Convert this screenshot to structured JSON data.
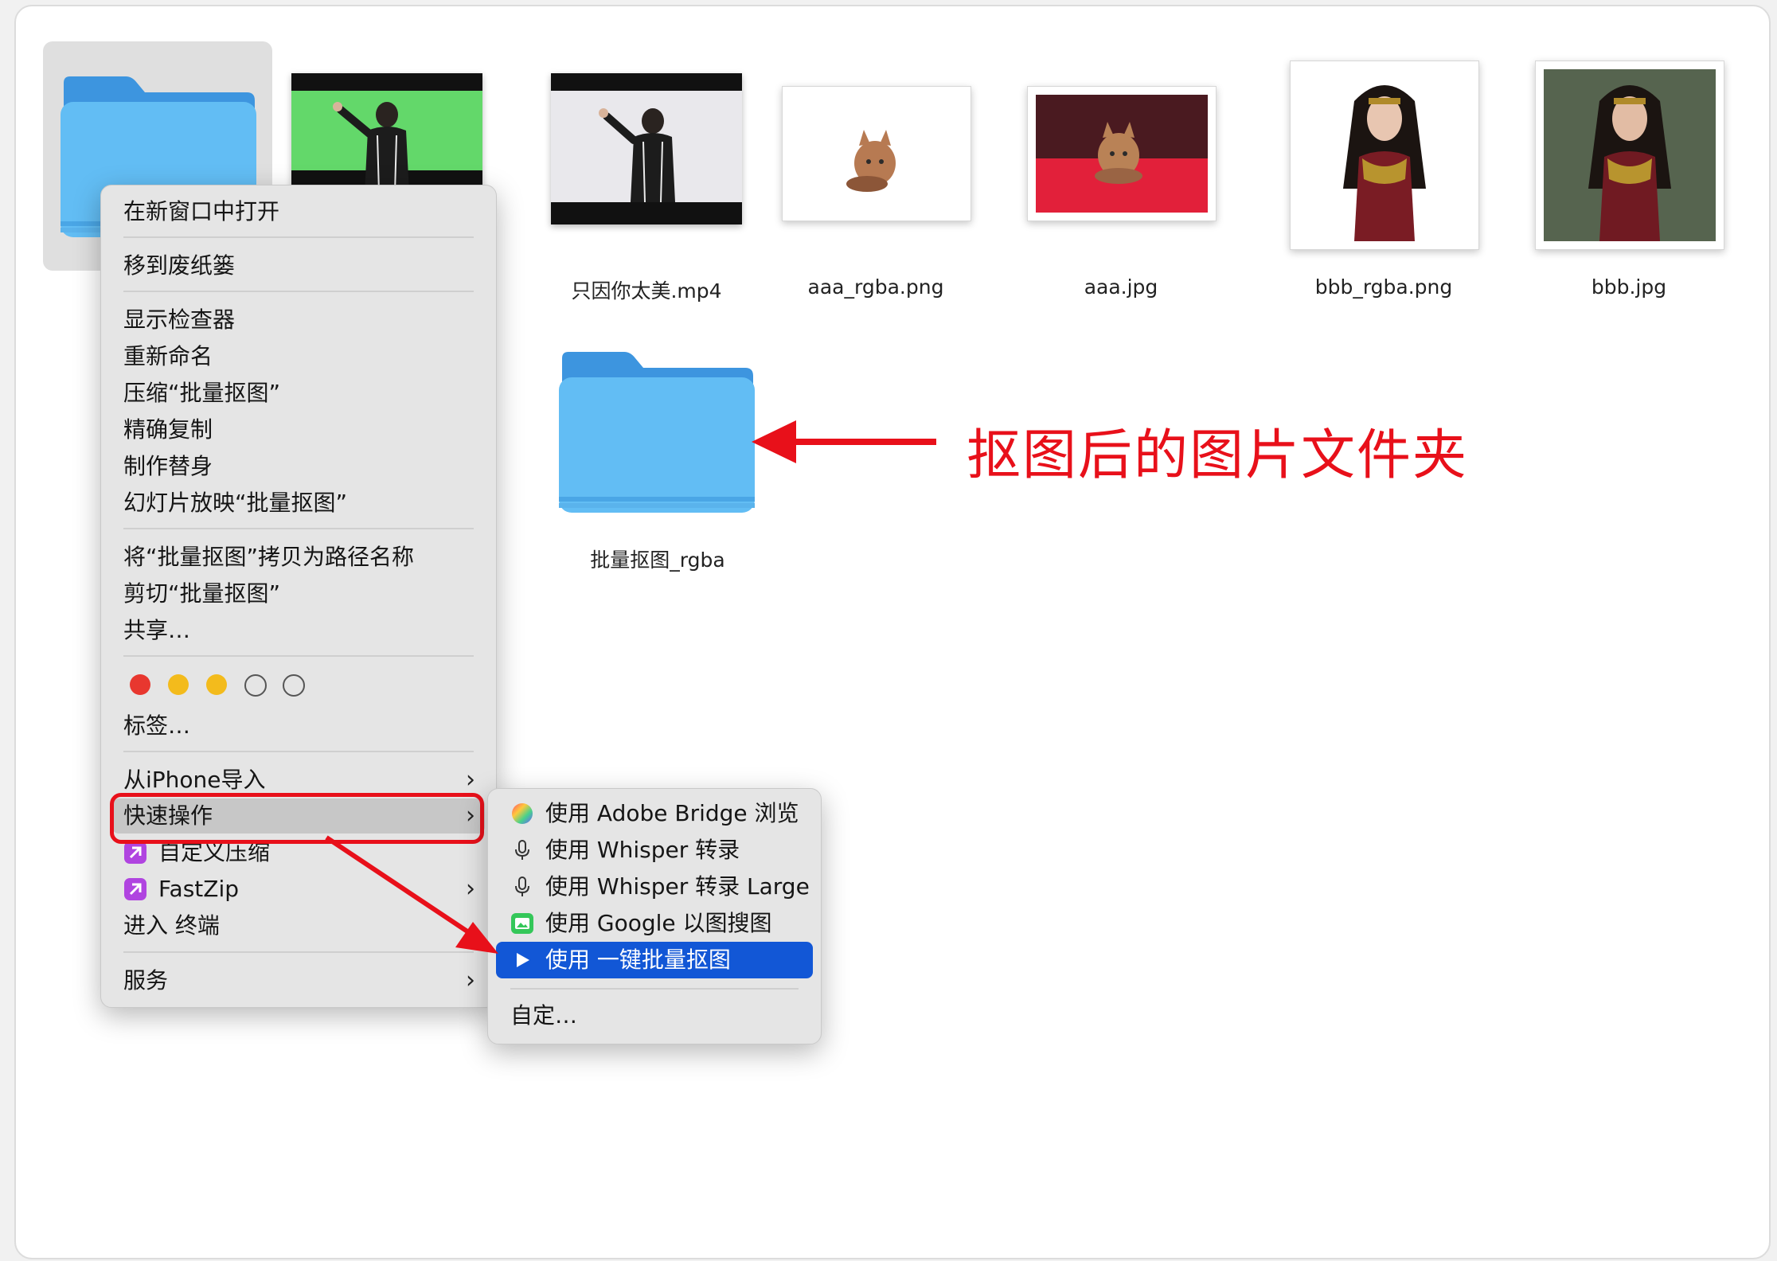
{
  "files": [
    {
      "name": "",
      "type": "folder",
      "selected": true
    },
    {
      "name": "",
      "type": "video-green"
    },
    {
      "name": "只因你太美.mp4",
      "type": "video"
    },
    {
      "name": "aaa_rgba.png",
      "type": "image-transparent-cat"
    },
    {
      "name": "aaa.jpg",
      "type": "image-cat"
    },
    {
      "name": "bbb_rgba.png",
      "type": "image-transparent-hero"
    },
    {
      "name": "bbb.jpg",
      "type": "image-hero"
    },
    {
      "name": "批量抠图_rgba",
      "type": "folder"
    }
  ],
  "annotation": {
    "text": "抠图后的图片文件夹",
    "color": "#e8101a"
  },
  "context_menu": {
    "open_new_window": "在新窗口中打开",
    "move_to_trash": "移到废纸篓",
    "show_inspector": "显示检查器",
    "rename": "重新命名",
    "compress": "压缩“批量抠图”",
    "duplicate": "精确复制",
    "make_alias": "制作替身",
    "slideshow": "幻灯片放映“批量抠图”",
    "copy_as_path": "将“批量抠图”拷贝为路径名称",
    "cut": "剪切“批量抠图”",
    "share": "共享…",
    "tags_label": "标签…",
    "tag_colors": [
      "#e8372f",
      "#f3bb1c",
      "#f3bb1c",
      "none",
      "none"
    ],
    "import_iphone": "从iPhone导入",
    "quick_actions": "快速操作",
    "custom_compress": "自定义压缩",
    "fastzip": "FastZip",
    "enter_terminal": "进入 终端",
    "services": "服务"
  },
  "submenu": {
    "adobe_bridge": "使用 Adobe Bridge 浏览",
    "whisper": "使用 Whisper 转录",
    "whisper_large": "使用 Whisper 转录 Large",
    "google_search": "使用 Google 以图搜图",
    "batch_matting": "使用 一键批量抠图",
    "customize": "自定…"
  },
  "colors": {
    "highlight_blue": "#1257d6",
    "annotation_red": "#e8101a",
    "folder_blue": "#5fb8f2"
  }
}
